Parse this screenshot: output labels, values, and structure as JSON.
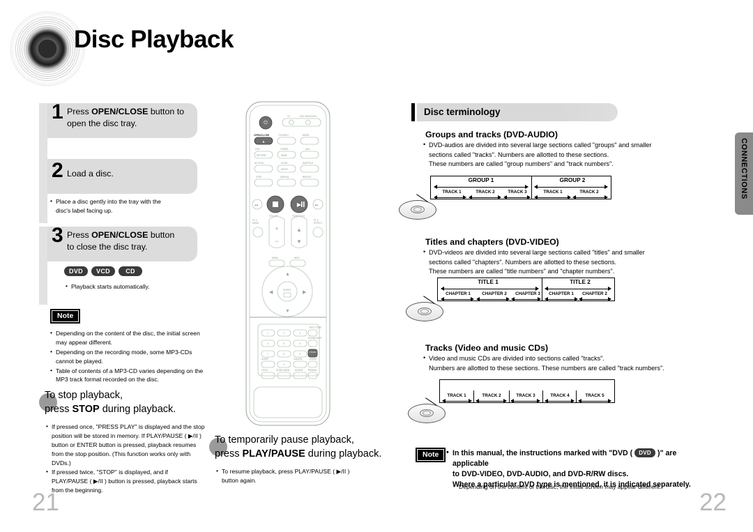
{
  "header": {
    "title": "Disc Playback",
    "speaker_icon": "speaker-graphic"
  },
  "steps": [
    {
      "num": "1",
      "line1_pre": "Press ",
      "line1_bold": "OPEN/CLOSE",
      "line1_post": " button to",
      "line2": "open the disc tray."
    },
    {
      "num": "2",
      "line1_pre": "",
      "line1_bold": "",
      "line1_post": "Load a disc.",
      "line2": ""
    },
    {
      "num": "3",
      "line1_pre": "Press ",
      "line1_bold": "OPEN/CLOSE",
      "line1_post": " button",
      "line2": "to close the disc tray."
    }
  ],
  "step2_bullets": [
    "Place a disc gently into the tray with the",
    "disc's label facing up."
  ],
  "badges": [
    "DVD",
    "VCD",
    "CD"
  ],
  "step3_bullet": "Playback starts automatically.",
  "note_label": "Note",
  "left_note_bullets": [
    "Depending on the content of the disc, the initial screen may appear different.",
    "Depending on the recording mode, some MP3-CDs cannot be played.",
    "Table of contents of a MP3-CD varies depending on the MP3 track format recorded on the disc."
  ],
  "stop_section": {
    "heading_line1": "To stop playback,",
    "heading_line2_pre": "press ",
    "heading_line2_bold": "STOP",
    "heading_line2_post": " during playback.",
    "bullets": [
      "If pressed once, \"PRESS PLAY\" is displayed and the stop position will be stored in memory. If PLAY/PAUSE ( ▶/II ) button or ENTER button is pressed, playback resumes from the stop position. (This function works only with DVDs.)",
      "If pressed twice, \"STOP\" is displayed, and if PLAY/PAUSE ( ▶/II ) button is pressed, playback starts from the beginning."
    ]
  },
  "pause_section": {
    "heading_line1": "To temporarily pause playback,",
    "heading_line2_pre": "press ",
    "heading_line2_bold": "PLAY/PAUSE",
    "heading_line2_post": " during playback.",
    "bullet": "To resume playback, press PLAY/PAUSE ( ▶/II ) button again."
  },
  "right": {
    "section_title": "Disc terminology",
    "groups": {
      "heading": "Groups and tracks (DVD-AUDIO)",
      "body_line1": "DVD-audios are divided into several large sections called \"groups\" and smaller",
      "body_line2": "sections called \"tracks\". Numbers are allotted to these sections.",
      "body_line3": "These numbers are called \"group numbers\" and \"track numbers\".",
      "diagram": {
        "top_labels": [
          "GROUP 1",
          "GROUP 2"
        ],
        "bottom_labels": [
          "TRACK 1",
          "TRACK 2",
          "TRACK 3",
          "TRACK 1",
          "TRACK 2"
        ]
      }
    },
    "titles": {
      "heading": "Titles and chapters (DVD-VIDEO)",
      "body_line1": "DVD-videos are divided into several large sections called \"titles\" and smaller",
      "body_line2": "sections called \"chapters\". Numbers are allotted to these sections.",
      "body_line3": "These numbers are called \"title numbers\" and \"chapter numbers\".",
      "diagram": {
        "top_labels": [
          "TITLE 1",
          "TITLE 2"
        ],
        "bottom_labels": [
          "CHAPTER 1",
          "CHAPTER 2",
          "CHAPTER 3",
          "CHAPTER 1",
          "CHAPTER 2"
        ]
      }
    },
    "tracks": {
      "heading": "Tracks (Video and music CDs)",
      "body_line1": "Video and music CDs are divided into sections called \"tracks\".",
      "body_line2": "Numbers are allotted to these sections. These numbers are called \"track numbers\".",
      "diagram": {
        "bottom_labels": [
          "TRACK 1",
          "TRACK 2",
          "TRACK 3",
          "TRACK 4",
          "TRACK 5"
        ]
      }
    },
    "note": {
      "label": "Note",
      "line1_a": "In this manual, the instructions marked with \"DVD (",
      "badge": "DVD",
      "line1_b": ")\" are applicable",
      "line2": "to DVD-VIDEO, DVD-AUDIO, and DVD-R/RW discs.",
      "line3": "Where a particular DVD type is mentioned, it is indicated separately.",
      "sub_bullet": "Depending on the content of the disc, the initial screen may appear different."
    }
  },
  "side_tab": {
    "label": "CONNECTIONS"
  },
  "page_numbers": {
    "left": "21",
    "right": "22"
  },
  "remote": {
    "power_label": "⏻/I",
    "tv_label": "TV",
    "dvd_receiver_label": "DVD RECEIVER",
    "open_close_label": "OPEN/CLOSE",
    "row_labels": [
      [
        "TV/VIDEO",
        "MODE"
      ],
      [
        "DVD",
        "TUNER",
        "AUX"
      ],
      [
        "AV SYNC",
        "SLOW",
        "SUBTITLE"
      ],
      [
        "STEP",
        "DSP/EQ",
        "REPEAT"
      ]
    ],
    "inner_labels": [
      "RETURN",
      "BAND",
      "MO/ST"
    ],
    "transport": [
      "◀◀",
      "■",
      "▶/II",
      "▶▶"
    ],
    "volume_label": "VOLUME",
    "tuning_label": "TUNING/CH",
    "pl_mode_label": "PL II MODE",
    "pl_effect_label": "PL II EFFECT",
    "menu_label": "MENU",
    "info_label": "INFO",
    "enter_label": "ENTER",
    "keypad": [
      "1",
      "2",
      "3",
      "4",
      "5",
      "6",
      "7",
      "8",
      "9",
      "0"
    ],
    "keypad_side": [
      "TEST TONE",
      "SOUND EDIT",
      "P.SCAN",
      "ZOOM"
    ],
    "bottom_row": [
      "STEP",
      "CANCEL",
      "ZOOM"
    ],
    "bottom_row2": [
      "LOGO",
      "SLIDE MODE",
      "DIGEST",
      "REMAIN"
    ]
  }
}
